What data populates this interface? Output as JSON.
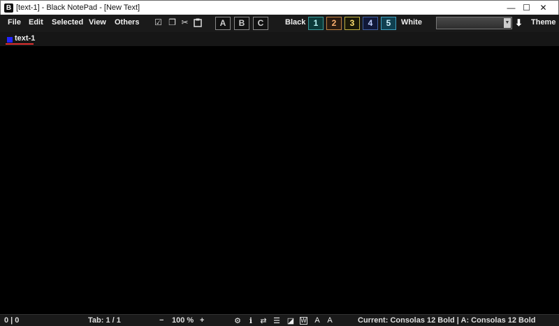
{
  "window": {
    "app_icon_letter": "B",
    "title": "[text-1] - Black NotePad - [New Text]",
    "min_glyph": "—",
    "max_glyph": "☐",
    "close_glyph": "✕"
  },
  "menu": {
    "file": "File",
    "edit": "Edit",
    "selected": "Selected",
    "view": "View",
    "others": "Others"
  },
  "tools": {
    "check_icon": "☑",
    "copy_icon": "❐",
    "cut_icon": "✂",
    "paste_icon": "📋"
  },
  "font_buttons": [
    "A",
    "B",
    "C"
  ],
  "theme": {
    "black_label": "Black",
    "numbers": [
      "1",
      "2",
      "3",
      "4",
      "5"
    ],
    "white_label": "White",
    "select_value": "",
    "download_icon": "⬇",
    "theme_label": "Theme"
  },
  "tabs": [
    {
      "label": "text-1",
      "dot_color": "#2222ff"
    }
  ],
  "status": {
    "position": "0 | 0",
    "tab": "Tab: 1 / 1",
    "zoom_minus": "−",
    "zoom": "100 %",
    "zoom_plus": "+",
    "icons": [
      "gear-icon",
      "info-icon",
      "swap-icon",
      "list-icon",
      "contrast-icon",
      "word-wrap-icon",
      "font-size-up-icon",
      "font-size-down-icon"
    ],
    "font_info": "Current: Consolas 12 Bold | A: Consolas 12 Bold"
  }
}
